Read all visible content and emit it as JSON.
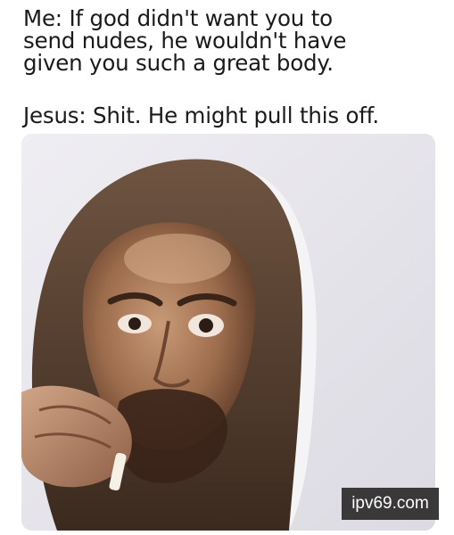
{
  "meme": {
    "setup_lines": [
      "Me: If god didn't want you to",
      "send nudes, he wouldn't have",
      "given you such a great body."
    ],
    "punchline": "Jesus: Shit. He might pull this off.",
    "watermark": "ipv69.com"
  },
  "colors": {
    "text": "#1a1a1a",
    "background": "#ffffff",
    "photo_background": "#e6e4ea",
    "watermark_background": "#3a3838",
    "watermark_text": "#ffffff"
  }
}
